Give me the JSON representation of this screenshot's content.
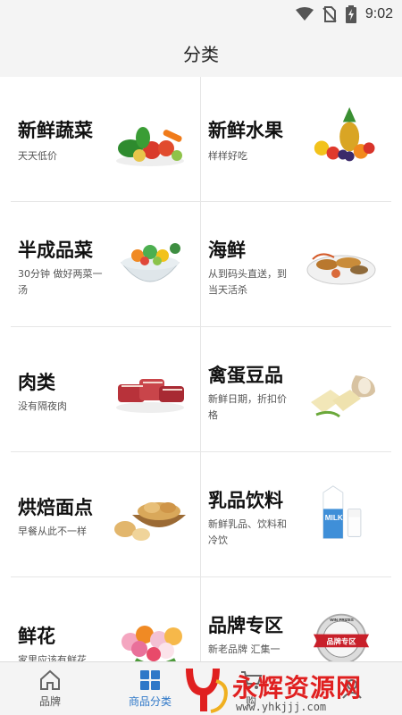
{
  "status_bar": {
    "time": "9:02"
  },
  "header": {
    "title": "分类"
  },
  "categories": [
    {
      "title": "新鲜蔬菜",
      "subtitle": "天天低价",
      "image": "vegetables"
    },
    {
      "title": "新鲜水果",
      "subtitle": "样样好吃",
      "image": "fruits"
    },
    {
      "title": "半成品菜",
      "subtitle": "30分钟 做好两菜一汤",
      "image": "salad-bowl"
    },
    {
      "title": "海鲜",
      "subtitle": "从到码头直送，到当天活杀",
      "image": "seafood-platter"
    },
    {
      "title": "肉类",
      "subtitle": "没有隔夜肉",
      "image": "meat"
    },
    {
      "title": "禽蛋豆品",
      "subtitle": "新鲜日期，折扣价格",
      "image": "eggs-tofu"
    },
    {
      "title": "烘焙面点",
      "subtitle": "早餐从此不一样",
      "image": "bread-basket"
    },
    {
      "title": "乳品饮料",
      "subtitle": "新鲜乳品、饮料和冷饮",
      "image": "milk",
      "image_text": "MILK"
    },
    {
      "title": "鲜花",
      "subtitle": "家里应该有鲜花",
      "image": "flowers"
    },
    {
      "title": "品牌专区",
      "subtitle": "新老品牌 汇集一",
      "image": "brand-badge",
      "badge_text": "品牌专区",
      "badge_ring": "WIN PRIZES"
    }
  ],
  "tabs": [
    {
      "label": "品牌",
      "icon": "home-icon",
      "active": false
    },
    {
      "label": "商品分类",
      "icon": "grid-icon",
      "active": true
    },
    {
      "label": "购",
      "icon": "cart-icon",
      "active": false
    },
    {
      "label": "",
      "icon": "user-icon",
      "active": false
    }
  ],
  "watermark": {
    "text": "永辉资源网",
    "url": "www.yhkjjj.com"
  },
  "colors": {
    "accent": "#2f78c8",
    "background": "#f4f4f4",
    "divider": "#e6e6e6",
    "watermark": "#e02020"
  }
}
